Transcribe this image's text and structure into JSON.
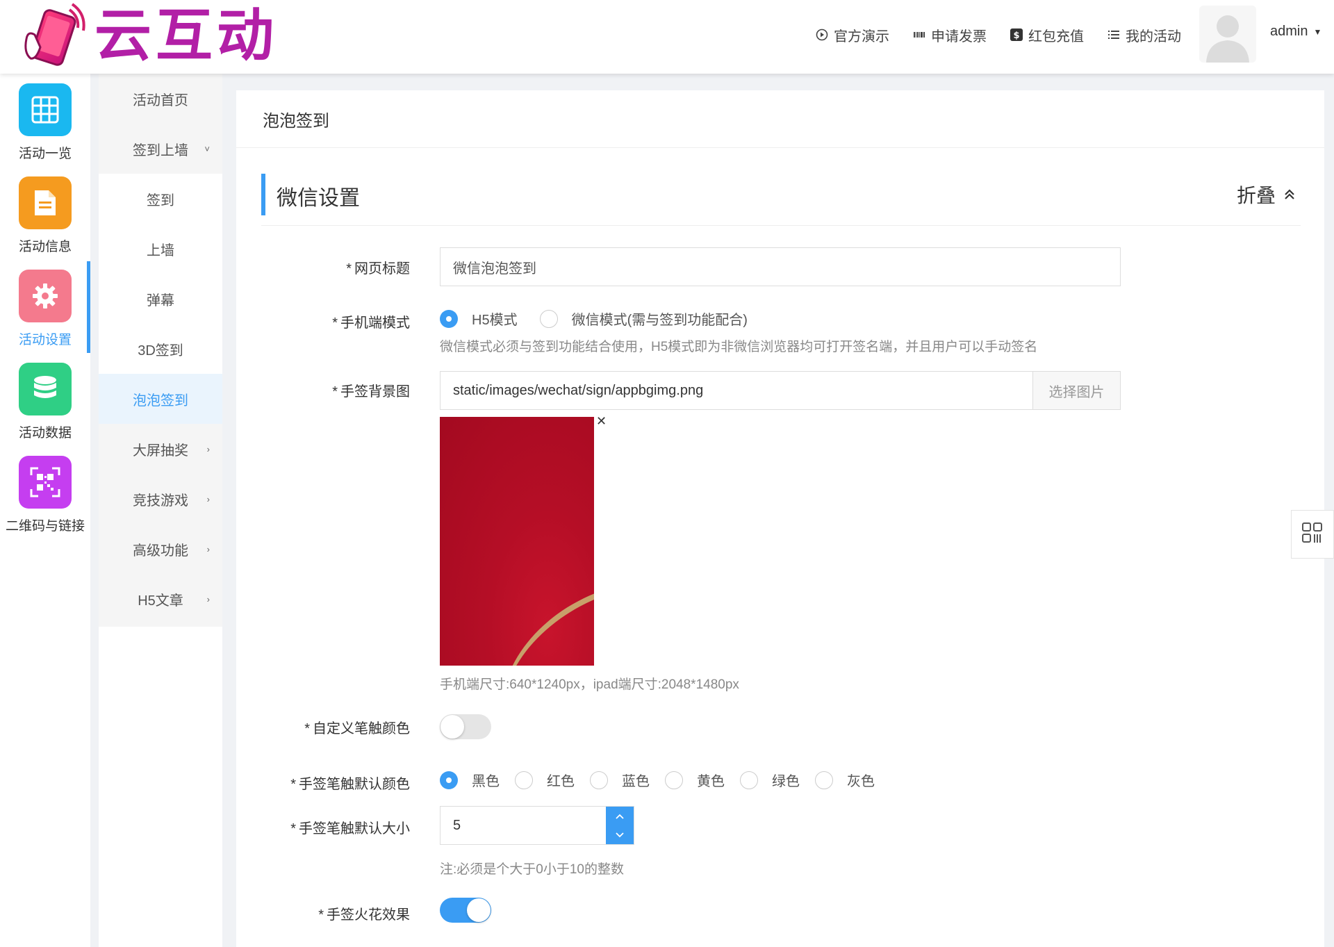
{
  "app": {
    "logo_text": "云互动",
    "colors": {
      "accent": "#3a9cf3",
      "logo_purple": "#b21fa6"
    }
  },
  "topnav": [
    {
      "label": "官方演示",
      "icon": "play-circle-icon"
    },
    {
      "label": "申请发票",
      "icon": "barcode-icon"
    },
    {
      "label": "红包充值",
      "icon": "dollar-icon"
    },
    {
      "label": "我的活动",
      "icon": "list-icon"
    }
  ],
  "user": {
    "name": "admin"
  },
  "rail": [
    {
      "label": "活动一览",
      "color": "#1ab8f0",
      "icon": "grid-icon"
    },
    {
      "label": "活动信息",
      "color": "#f59b1f",
      "icon": "document-icon"
    },
    {
      "label": "活动设置",
      "color": "#f47a8d",
      "icon": "gear-icon",
      "active": true
    },
    {
      "label": "活动数据",
      "color": "#2fcf85",
      "icon": "database-icon"
    },
    {
      "label": "二维码与链接",
      "color": "#c53ef0",
      "icon": "qrcode-icon"
    }
  ],
  "subnav": [
    {
      "label": "活动首页"
    },
    {
      "label": "签到上墙",
      "chev": "˅"
    },
    {
      "label": "签到"
    },
    {
      "label": "上墙"
    },
    {
      "label": "弹幕"
    },
    {
      "label": "3D签到"
    },
    {
      "label": "泡泡签到",
      "active": true
    },
    {
      "label": "大屏抽奖",
      "chev": "›"
    },
    {
      "label": "竞技游戏",
      "chev": "›"
    },
    {
      "label": "高级功能",
      "chev": "›"
    },
    {
      "label": "H5文章",
      "chev": "›"
    }
  ],
  "page": {
    "title": "泡泡签到",
    "section_title": "微信设置",
    "collapse_label": "折叠"
  },
  "form": {
    "page_title_label": "网页标题",
    "page_title_value": "微信泡泡签到",
    "mobile_mode_label": "手机端模式",
    "mobile_mode_options": [
      "H5模式",
      "微信模式(需与签到功能配合)"
    ],
    "mobile_mode_selected": "H5模式",
    "mobile_mode_help": "微信模式必须与签到功能结合使用，H5模式即为非微信浏览器均可打开签名端，并且用户可以手动签名",
    "bg_label": "手签背景图",
    "bg_path": "static/images/wechat/sign/appbgimg.png",
    "bg_button": "选择图片",
    "bg_help": "手机端尺寸:640*1240px，ipad端尺寸:2048*1480px",
    "custom_color_label": "自定义笔触颜色",
    "custom_color_on": false,
    "default_color_label": "手签笔触默认颜色",
    "default_color_options": [
      "黑色",
      "红色",
      "蓝色",
      "黄色",
      "绿色",
      "灰色"
    ],
    "default_color_selected": "黑色",
    "default_size_label": "手签笔触默认大小",
    "default_size_value": "5",
    "default_size_help": "注:必须是个大于0小于10的整数",
    "spark_label": "手签火花效果",
    "spark_on": true
  }
}
